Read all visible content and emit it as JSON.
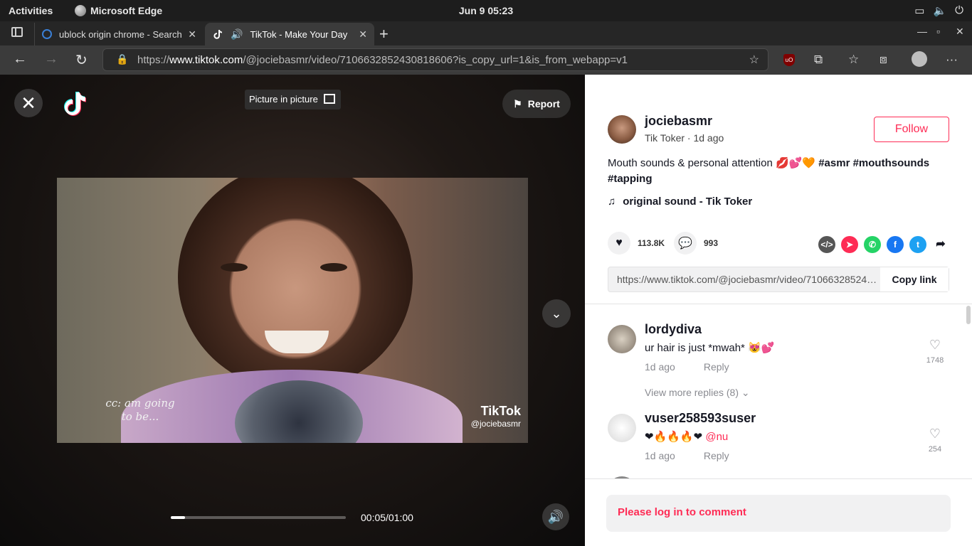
{
  "os_bar": {
    "activities": "Activities",
    "app_name": "Microsoft Edge",
    "clock": "Jun 9  05:23"
  },
  "tabs": [
    {
      "title": "ublock origin chrome - Search",
      "active": false
    },
    {
      "title": "TikTok - Make Your Day",
      "active": true
    }
  ],
  "toolbar": {
    "url_prefix": "https://",
    "url_domain": "www.tiktok.com",
    "url_path": "/@jociebasmr/video/7106632852430818606?is_copy_url=1&is_from_webapp=v1"
  },
  "video": {
    "pip_label": "Picture in picture",
    "report_label": "Report",
    "caption": "cc: am going to be...",
    "watermark_brand": "TikTok",
    "watermark_user": "@jociebasmr",
    "progress_fraction": 0.083,
    "time": "00:05/01:00"
  },
  "post": {
    "author": "jociebasmr",
    "sub": "Tik Toker · 1d ago",
    "follow_label": "Follow",
    "desc_text": "Mouth sounds & personal attention 💋💕🧡",
    "desc_tags": "#asmr #mouthsounds #tapping",
    "sound": "original sound - Tik Toker",
    "likes": "113.8K",
    "comments_count": "993",
    "link": "https://www.tiktok.com/@jociebasmr/video/7106632852430818606?is_copy_url=1&is_from_webapp=v1",
    "copy_label": "Copy link"
  },
  "comments": [
    {
      "user": "lordydiva",
      "text": "ur hair is just *mwah* 😻💕",
      "mention": "",
      "age": "1d ago",
      "reply": "Reply",
      "likes": "1748"
    },
    {
      "user": "vuser258593suser",
      "text": "❤🔥🔥🔥❤",
      "mention": "@nu",
      "age": "1d ago",
      "reply": "Reply",
      "likes": "254"
    }
  ],
  "view_more": "View more replies (8)",
  "login_prompt": "Please log in to comment",
  "colors": {
    "brand": "#fe2c55",
    "panel": "#ffffff",
    "chrome": "#3b3b3b"
  }
}
